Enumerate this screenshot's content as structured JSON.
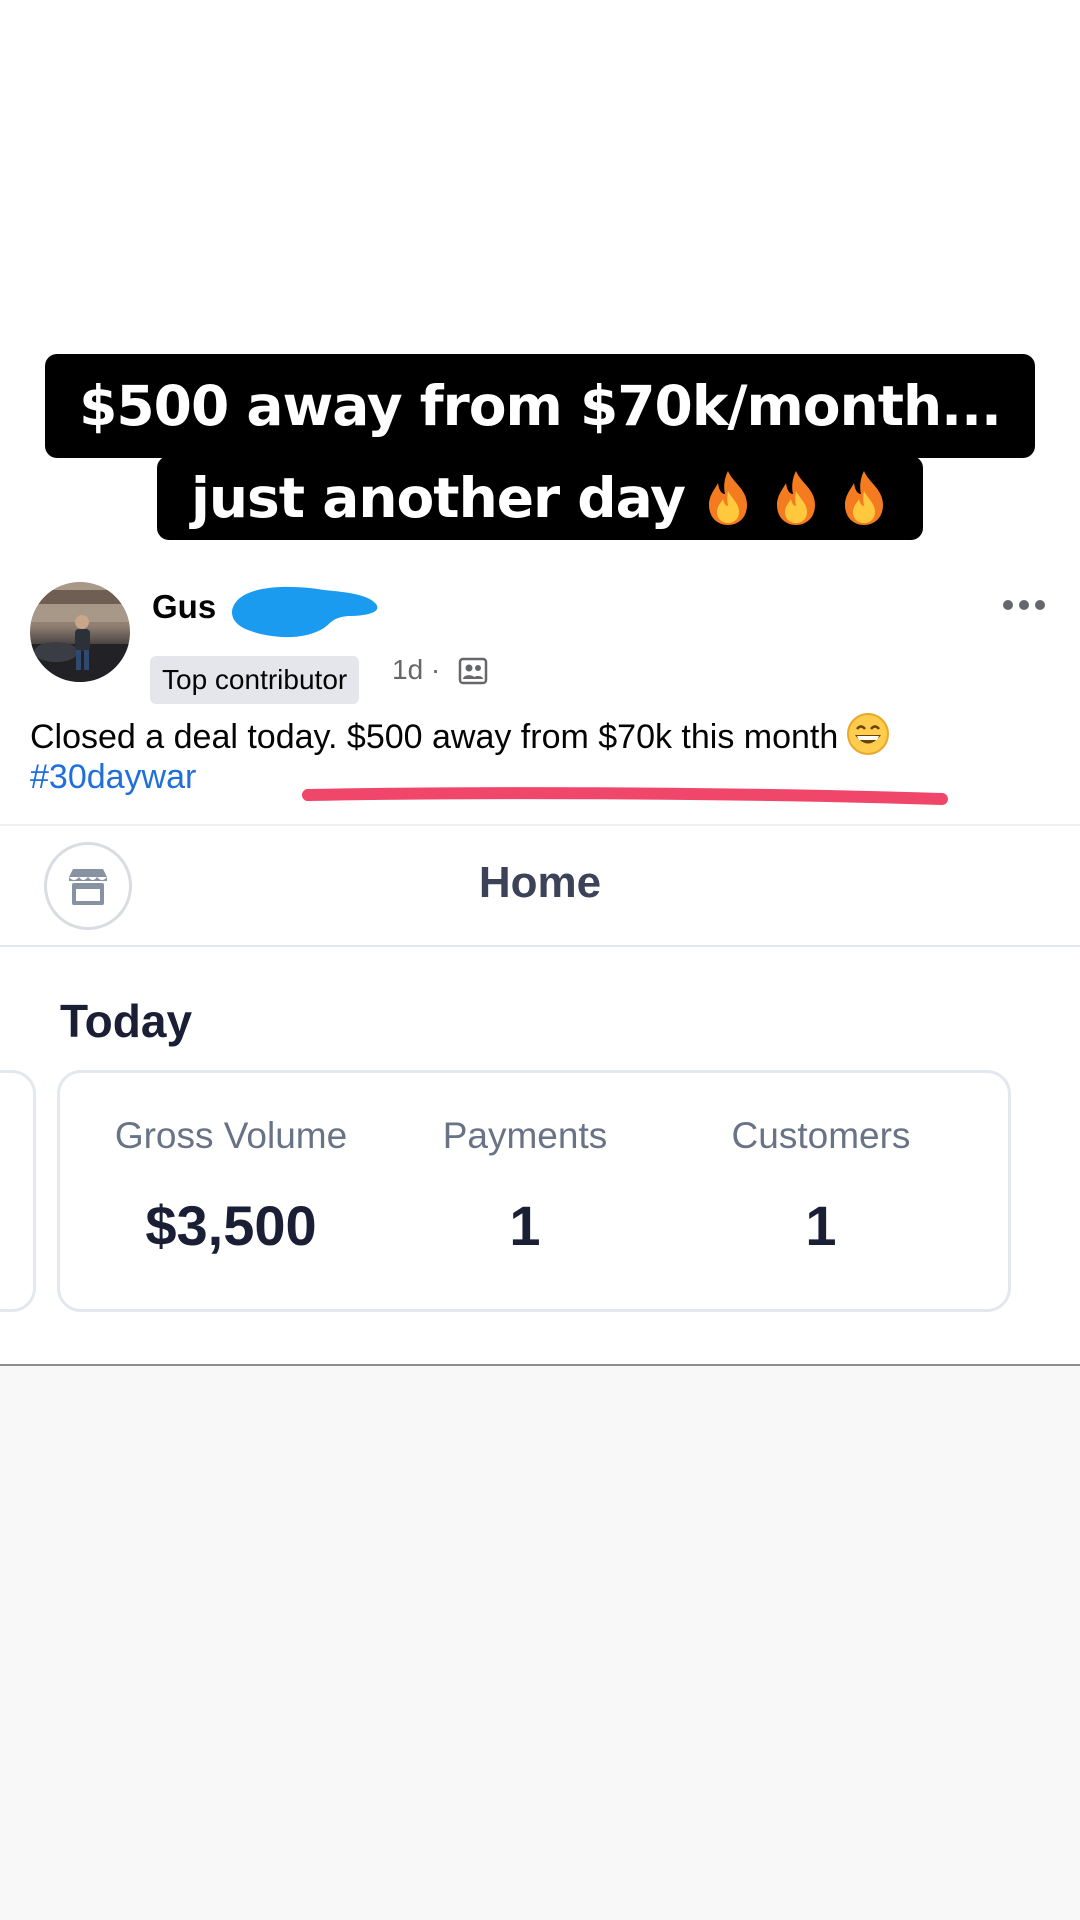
{
  "story_caption": {
    "line1": "$500 away from $70k/month...",
    "line2": "just another day",
    "emoji_icons": [
      "fire-icon",
      "fire-icon",
      "fire-icon"
    ]
  },
  "post": {
    "author_first_name": "Gus",
    "author_last_name_redacted": true,
    "badge": "Top contributor",
    "time": "1d ·",
    "audience_icon": "group-audience-icon",
    "more_icon": "more-horizontal-icon",
    "text": "Closed a deal today. $500 away from $70k this month",
    "text_emoji": "grinning-face-icon",
    "hashtag": "#30daywar",
    "highlight_color": "#f0466a",
    "redaction_color": "#1a9bf0"
  },
  "dashboard": {
    "title": "Home",
    "store_icon": "store-icon",
    "section_title": "Today",
    "stats": [
      {
        "label": "Gross Volume",
        "value": "$3,500"
      },
      {
        "label": "Payments",
        "value": "1"
      },
      {
        "label": "Customers",
        "value": "1"
      }
    ]
  }
}
